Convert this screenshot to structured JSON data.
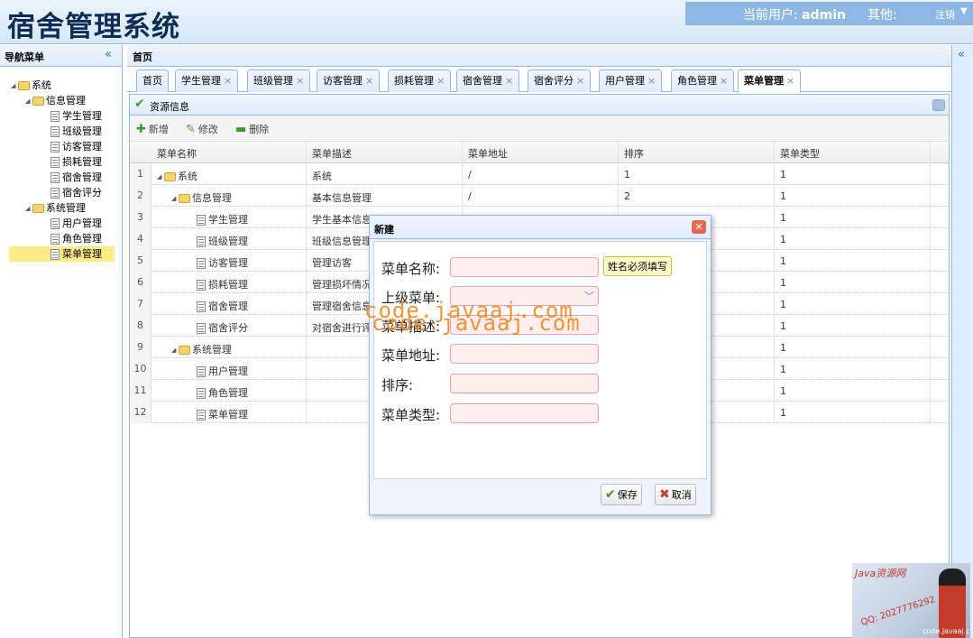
{
  "header": {
    "app_title": "宿舍管理系统",
    "current_user_label": "当前用户:",
    "current_user": "admin",
    "other_label": "其他:",
    "logout": "注销"
  },
  "sidebar": {
    "title": "导航菜单",
    "collapse_icon": "«",
    "tree": [
      {
        "label": "系统",
        "level": 0,
        "type": "folder"
      },
      {
        "label": "信息管理",
        "level": 1,
        "type": "folder"
      },
      {
        "label": "学生管理",
        "level": 2,
        "type": "file"
      },
      {
        "label": "班级管理",
        "level": 2,
        "type": "file"
      },
      {
        "label": "访客管理",
        "level": 2,
        "type": "file"
      },
      {
        "label": "损耗管理",
        "level": 2,
        "type": "file"
      },
      {
        "label": "宿舍管理",
        "level": 2,
        "type": "file"
      },
      {
        "label": "宿舍评分",
        "level": 2,
        "type": "file"
      },
      {
        "label": "系统管理",
        "level": 1,
        "type": "folder"
      },
      {
        "label": "用户管理",
        "level": 2,
        "type": "file"
      },
      {
        "label": "角色管理",
        "level": 2,
        "type": "file"
      },
      {
        "label": "菜单管理",
        "level": 2,
        "type": "file",
        "selected": true
      }
    ]
  },
  "main": {
    "title": "首页",
    "expand_icon": "«",
    "tabs": [
      {
        "label": "首页",
        "closable": false
      },
      {
        "label": "学生管理",
        "closable": true
      },
      {
        "label": "班级管理",
        "closable": true
      },
      {
        "label": "访客管理",
        "closable": true
      },
      {
        "label": "损耗管理",
        "closable": true
      },
      {
        "label": "宿舍管理",
        "closable": true
      },
      {
        "label": "宿舍评分",
        "closable": true
      },
      {
        "label": "用户管理",
        "closable": true
      },
      {
        "label": "角色管理",
        "closable": true
      },
      {
        "label": "菜单管理",
        "closable": true,
        "active": true
      }
    ],
    "panel_title": "资源信息",
    "toolbar": {
      "add": "新增",
      "edit": "修改",
      "delete": "删除"
    },
    "grid": {
      "columns": [
        "菜单名称",
        "菜单描述",
        "菜单地址",
        "排序",
        "菜单类型"
      ],
      "rows": [
        {
          "num": "1",
          "name": "系统",
          "level": 0,
          "type": "folder",
          "desc": "系统",
          "url": "/",
          "sort": "1",
          "mtype": "1"
        },
        {
          "num": "2",
          "name": "信息管理",
          "level": 1,
          "type": "folder",
          "desc": "基本信息管理",
          "url": "/",
          "sort": "2",
          "mtype": "1"
        },
        {
          "num": "3",
          "name": "学生管理",
          "level": 2,
          "type": "file",
          "desc": "学生基本信息管理",
          "url": "",
          "sort": "",
          "mtype": "1"
        },
        {
          "num": "4",
          "name": "班级管理",
          "level": 2,
          "type": "file",
          "desc": "班级信息管理",
          "url": "",
          "sort": "",
          "mtype": "1"
        },
        {
          "num": "5",
          "name": "访客管理",
          "level": 2,
          "type": "file",
          "desc": "管理访客",
          "url": "",
          "sort": "",
          "mtype": "1"
        },
        {
          "num": "6",
          "name": "损耗管理",
          "level": 2,
          "type": "file",
          "desc": "管理损坏情况",
          "url": "",
          "sort": "",
          "mtype": "1"
        },
        {
          "num": "7",
          "name": "宿舍管理",
          "level": 2,
          "type": "file",
          "desc": "管理宿舍信息",
          "url": "",
          "sort": "",
          "mtype": "1"
        },
        {
          "num": "8",
          "name": "宿舍评分",
          "level": 2,
          "type": "file",
          "desc": "对宿舍进行评分",
          "url": "",
          "sort": "",
          "mtype": "1"
        },
        {
          "num": "9",
          "name": "系统管理",
          "level": 1,
          "type": "folder",
          "desc": "",
          "url": "",
          "sort": "",
          "mtype": "1"
        },
        {
          "num": "10",
          "name": "用户管理",
          "level": 2,
          "type": "file",
          "desc": "",
          "url": "",
          "sort": "",
          "mtype": "1"
        },
        {
          "num": "11",
          "name": "角色管理",
          "level": 2,
          "type": "file",
          "desc": "",
          "url": "",
          "sort": "",
          "mtype": "1"
        },
        {
          "num": "12",
          "name": "菜单管理",
          "level": 2,
          "type": "file",
          "desc": "",
          "url": "",
          "sort": "",
          "mtype": "1"
        }
      ]
    }
  },
  "dialog": {
    "title": "新建",
    "close_icon": "✕",
    "fields": {
      "name": {
        "label": "菜单名称:",
        "value": ""
      },
      "parent": {
        "label": "上级菜单:",
        "value": ""
      },
      "desc": {
        "label": "菜单描述:",
        "value": ""
      },
      "url": {
        "label": "菜单地址:",
        "value": ""
      },
      "sort": {
        "label": "排序:",
        "value": ""
      },
      "type": {
        "label": "菜单类型:",
        "value": ""
      }
    },
    "validation_tip": "姓名必须填写",
    "save": "保存",
    "cancel": "取消"
  },
  "overlay": {
    "watermark": "code.javaaj.com",
    "promo_title": "Java资源网",
    "promo_qq": "QQ: 2027776292",
    "promo_url": "code.javaaj.com"
  },
  "colors": {
    "accent": "#95b8e7",
    "header_bg": "#d6e8f7",
    "selected": "#fbec88",
    "required_bg": "#ffeeee"
  }
}
